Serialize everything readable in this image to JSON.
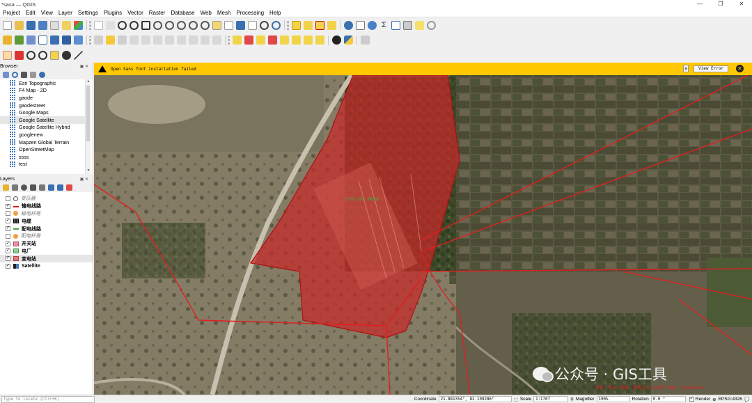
{
  "window": {
    "title": "*sasa — QGIS",
    "controls": [
      "—",
      "❐",
      "✕"
    ]
  },
  "menu": [
    "Project",
    "Edit",
    "View",
    "Layer",
    "Settings",
    "Plugins",
    "Vector",
    "Raster",
    "Database",
    "Web",
    "Mesh",
    "Processing",
    "Help"
  ],
  "browser": {
    "title": "Browser",
    "items": [
      "Esri Topographic",
      "F4 Map - 2D",
      "gaode",
      "gaodestreet",
      "Google Maps",
      "Google Satellite",
      "Google Satellite Hybrid",
      "googlenew",
      "Mapzen Global Terrain",
      "OpenStreetMap",
      "ssss",
      "test"
    ],
    "selected_index": 5
  },
  "layers": {
    "title": "Layers",
    "items": [
      {
        "label": "变压器",
        "checked": false,
        "style": "italic",
        "symbol": "circle"
      },
      {
        "label": "输电线路",
        "checked": true,
        "style": "bold",
        "symbol": "line-red"
      },
      {
        "label": "输电杆塔",
        "checked": false,
        "style": "italic",
        "symbol": "dot-orange"
      },
      {
        "label": "电缆",
        "checked": true,
        "style": "bold",
        "symbol": "line-dash"
      },
      {
        "label": "配电线路",
        "checked": true,
        "style": "bold",
        "symbol": "line-green"
      },
      {
        "label": "配电杆塔",
        "checked": false,
        "style": "italic",
        "symbol": "dot-orange"
      },
      {
        "label": "开关站",
        "checked": true,
        "style": "bold",
        "symbol": "fill-pink"
      },
      {
        "label": "电厂",
        "checked": true,
        "style": "bold",
        "symbol": "fill-green"
      },
      {
        "label": "变电站",
        "checked": true,
        "style": "bold",
        "symbol": "fill-red"
      },
      {
        "label": "Satellite",
        "checked": true,
        "style": "bold",
        "symbol": "raster"
      }
    ],
    "selected_index": 8
  },
  "message": {
    "text": "Open Sans font installation failed",
    "button": "View Error"
  },
  "map": {
    "feature_label": "Station Name",
    "watermark": "公众号 · GIS工具",
    "footer_note": "宗旨：专业，精准，服务至上(公众号）微信：1234567894"
  },
  "status": {
    "locate_placeholder": "Type to locate (Ctrl+K)",
    "coordinate_label": "Coordinate",
    "coordinate": "21.881354°, 82.109286°",
    "scale_label": "Scale",
    "scale": "1:1707",
    "magnifier_label": "Magnifier",
    "magnifier": "100%",
    "rotation_label": "Rotation",
    "rotation": "0.0 °",
    "render_label": "Render",
    "crs": "EPSG:4326"
  },
  "colors": {
    "message_bar": "#ffc800",
    "selection": "#c00000",
    "substation_fill": "#c82828"
  }
}
